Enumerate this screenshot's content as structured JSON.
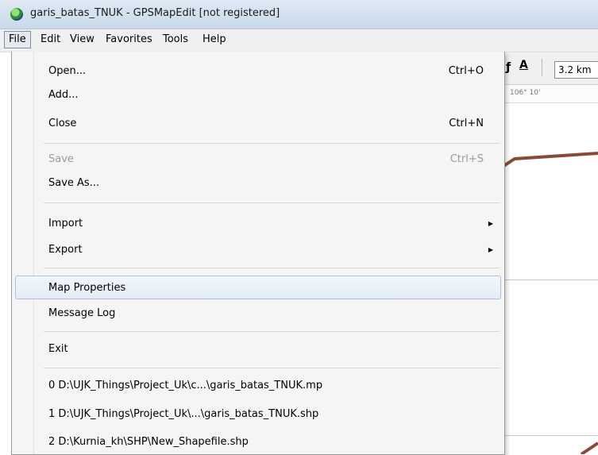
{
  "window": {
    "title": "garis_batas_TNUK - GPSMapEdit [not registered]"
  },
  "menubar": {
    "items": [
      "File",
      "Edit",
      "View",
      "Favorites",
      "Tools",
      "Help"
    ]
  },
  "toolbar": {
    "scale_value": "3.2 km",
    "ruler_text": "106° 10'"
  },
  "file_menu": {
    "open": {
      "label": "Open...",
      "shortcut": "Ctrl+O"
    },
    "add": {
      "label": "Add..."
    },
    "close": {
      "label": "Close",
      "shortcut": "Ctrl+N"
    },
    "save": {
      "label": "Save",
      "shortcut": "Ctrl+S"
    },
    "save_as": {
      "label": "Save As..."
    },
    "import": {
      "label": "Import"
    },
    "export": {
      "label": "Export"
    },
    "map_properties": {
      "label": "Map Properties"
    },
    "message_log": {
      "label": "Message Log"
    },
    "exit": {
      "label": "Exit"
    },
    "recent_files": [
      "0 D:\\UJK_Things\\Project_Uk\\c...\\garis_batas_TNUK.mp",
      "1 D:\\UJK_Things\\Project_Uk\\...\\garis_batas_TNUK.shp",
      "2 D:\\Kurnia_kh\\SHP\\New_Shapefile.shp"
    ]
  },
  "colors": {
    "map_line": "#8b4a37",
    "highlight_border": "#a8c0dd",
    "titlebar": "#c9d9ea"
  },
  "icons": {
    "app": "gpsmapedit-globe-icon",
    "submenu": "submenu-arrow-icon"
  }
}
